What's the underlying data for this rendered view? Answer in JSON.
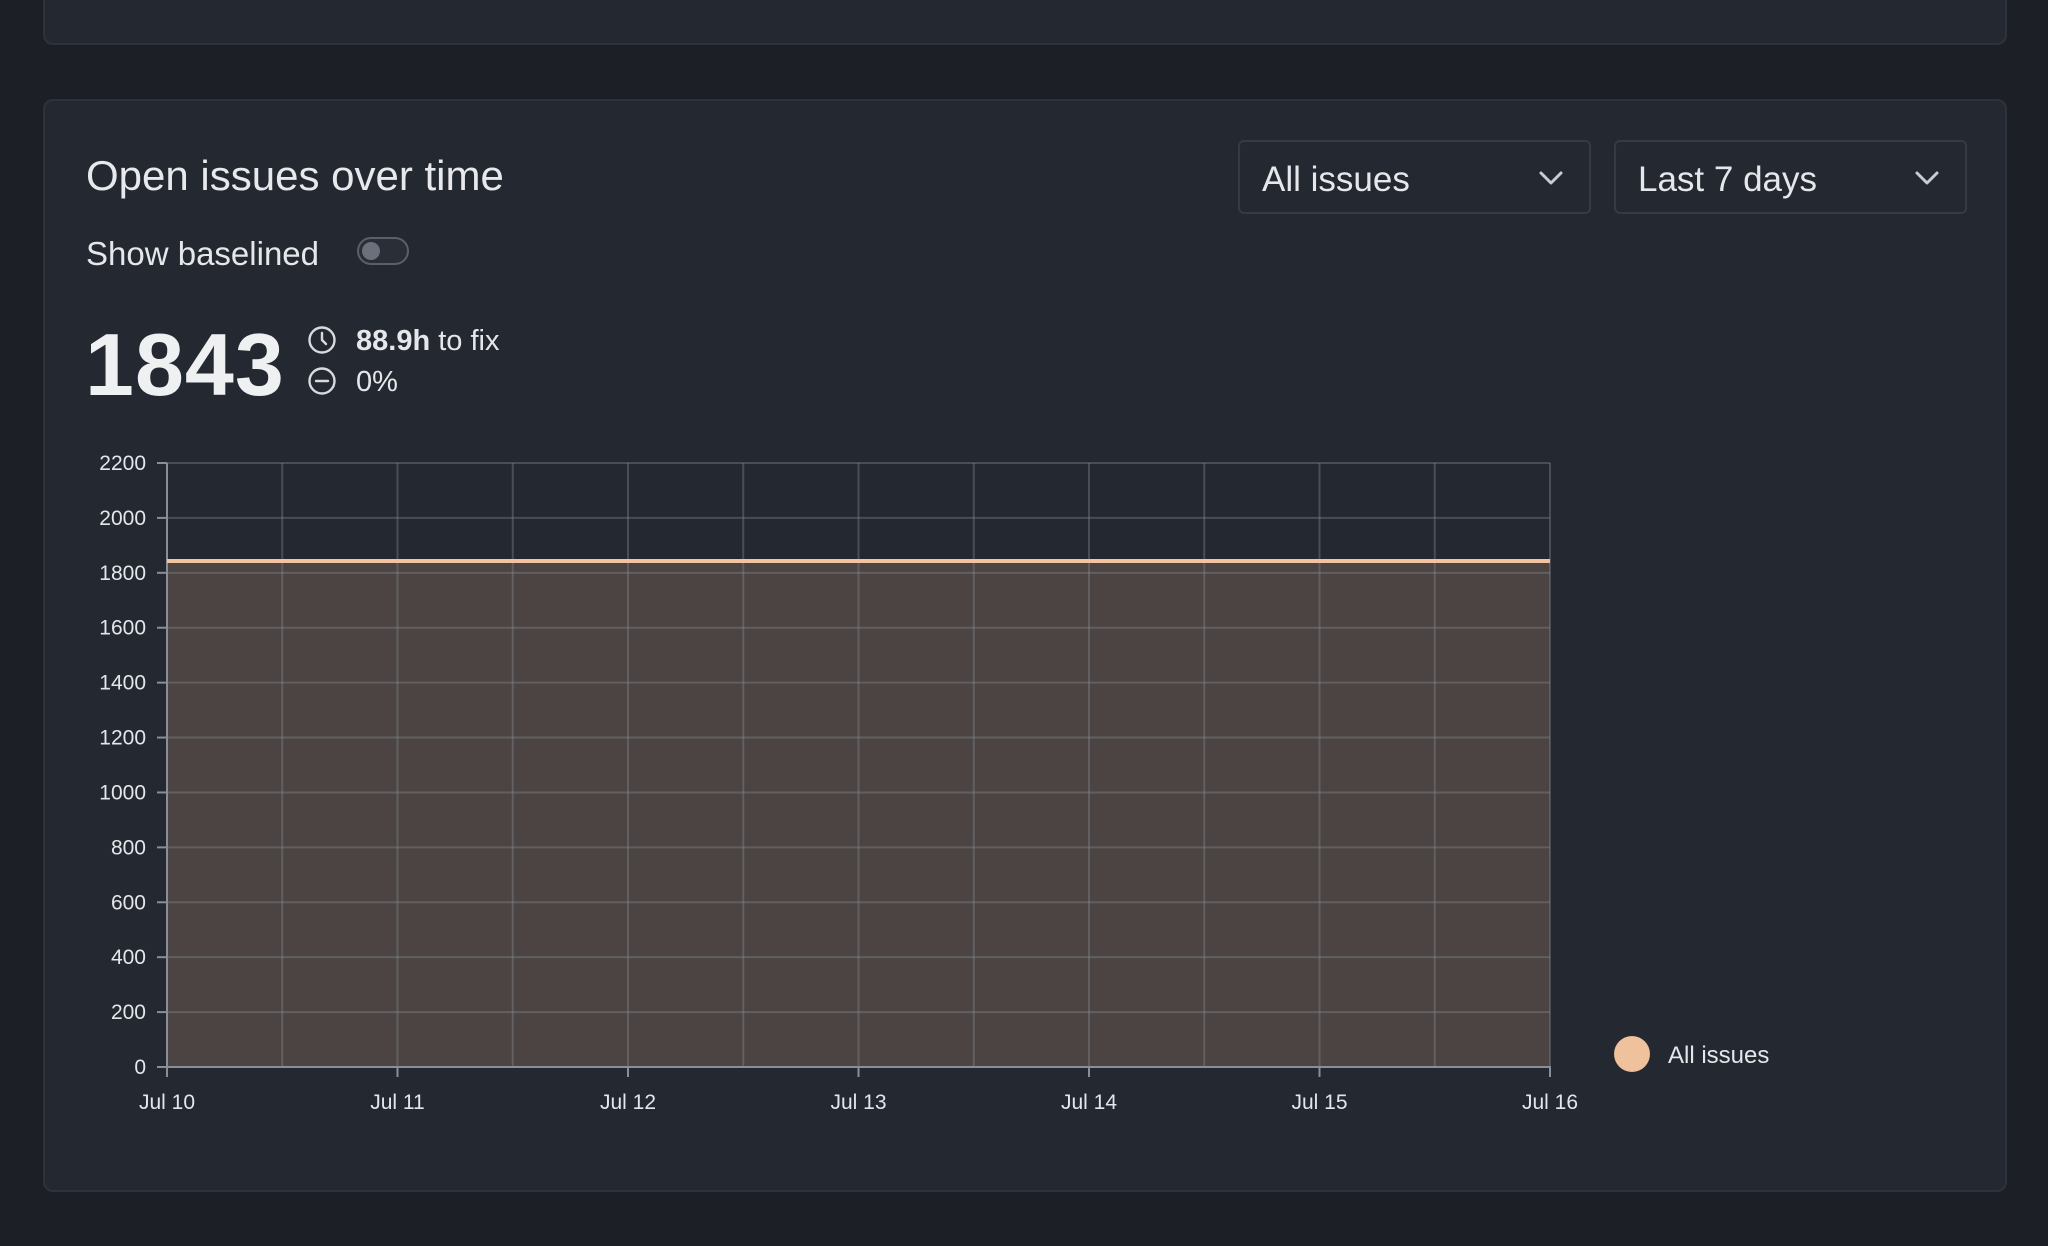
{
  "card": {
    "title": "Open issues over time",
    "issue_filter": {
      "value": "All issues"
    },
    "range_filter": {
      "value": "Last 7 days"
    },
    "toggle": {
      "label": "Show baselined",
      "on": false
    },
    "summary": {
      "count": "1843",
      "time_to_fix_value": "88.9h",
      "time_to_fix_suffix": " to fix",
      "change": "0%"
    }
  },
  "icons": {
    "filter_chevron": "chevron-down-icon",
    "time": "clock-icon",
    "change": "minus-circle-icon"
  },
  "colors": {
    "series_line": "#f2c39f",
    "series_fill": "#4b4443",
    "legend_dot": "#efc19d"
  },
  "chart_data": {
    "type": "area",
    "x": [
      "Jul 10",
      "Jul 11",
      "Jul 12",
      "Jul 13",
      "Jul 14",
      "Jul 15",
      "Jul 16"
    ],
    "series": [
      {
        "name": "All issues",
        "values": [
          1843,
          1843,
          1843,
          1843,
          1843,
          1843,
          1843
        ]
      }
    ],
    "ylim": [
      0,
      2200
    ],
    "yticks": [
      0,
      200,
      400,
      600,
      800,
      1000,
      1200,
      1400,
      1600,
      1800,
      2000,
      2200
    ],
    "grid": true,
    "legend": "right"
  }
}
